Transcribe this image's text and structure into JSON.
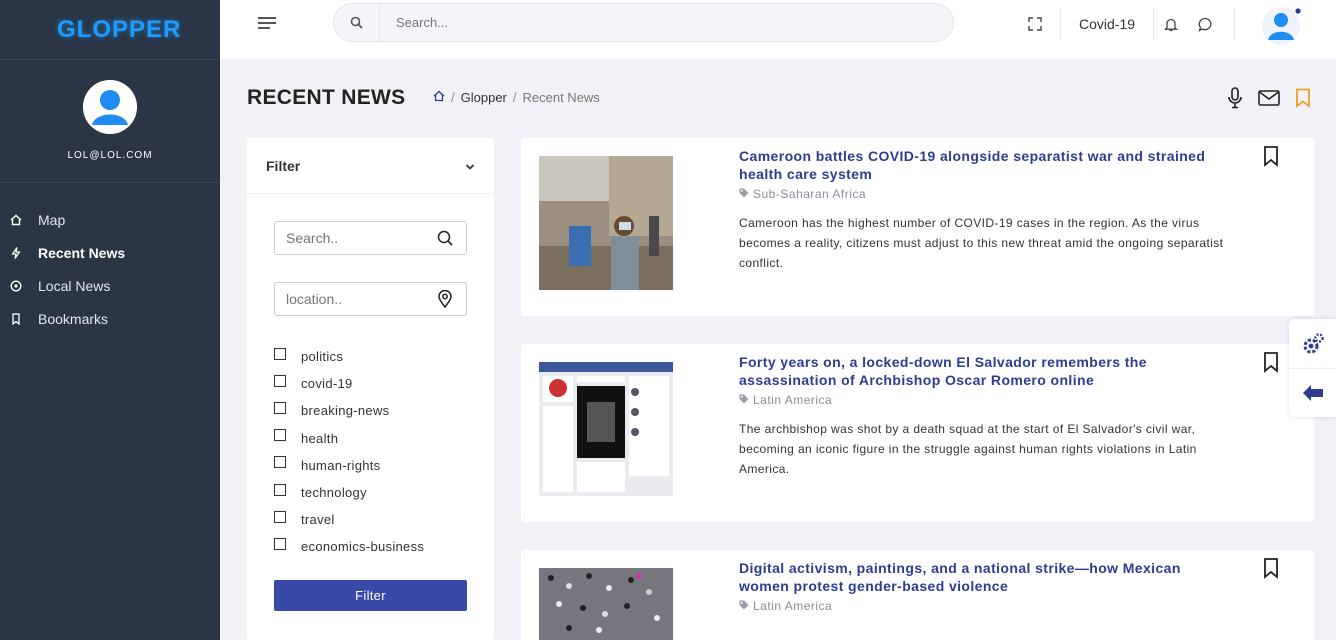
{
  "sidebar": {
    "brand": "GLOPPER",
    "user_email": "LOL@LOL.COM",
    "items": [
      {
        "label": "Map",
        "icon": "home-icon"
      },
      {
        "label": "Recent News",
        "icon": "bolt-icon"
      },
      {
        "label": "Local News",
        "icon": "location-icon"
      },
      {
        "label": "Bookmarks",
        "icon": "bookmark-icon"
      }
    ]
  },
  "header": {
    "search_placeholder": "Search...",
    "covid_label": "Covid-19"
  },
  "page": {
    "title": "RECENT NEWS",
    "breadcrumb": {
      "parent": "Glopper",
      "current": "Recent News"
    }
  },
  "filter": {
    "title": "Filter",
    "search_placeholder": "Search..",
    "location_placeholder": "location..",
    "tags": [
      "politics",
      "covid-19",
      "breaking-news",
      "health",
      "human-rights",
      "technology",
      "travel",
      "economics-business"
    ],
    "button_label": "Filter"
  },
  "news": [
    {
      "title": "Cameroon battles COVID-19 alongside separatist war and strained health care system",
      "category": "Sub-Saharan Africa",
      "description": "Cameroon has the highest number of COVID-19 cases in the region. As the virus becomes a reality, citizens must adjust to this new threat amid the ongoing separatist conflict."
    },
    {
      "title": "Forty years on, a locked-down El Salvador remembers the assassination of Archbishop Oscar Romero online",
      "category": "Latin America",
      "description": "The archbishop was shot by a death squad at the start of El Salvador's civil war, becoming an iconic figure in the struggle against human rights violations in Latin America."
    },
    {
      "title": "Digital activism, paintings, and a national strike—how Mexican women protest gender-based violence",
      "category": "Latin America",
      "description": ""
    }
  ],
  "colors": {
    "sidebar": "#2a3545",
    "brand": "#1e9bff",
    "accent": "#3949a8",
    "headline": "#2e3d8f",
    "bookmark_active": "#f0a020"
  }
}
